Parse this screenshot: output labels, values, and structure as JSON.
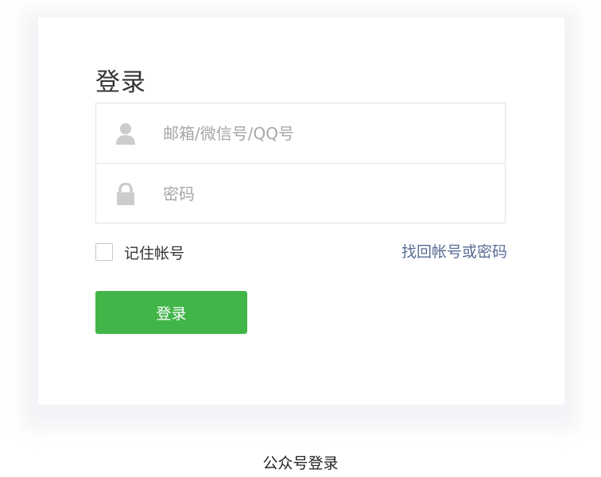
{
  "login_card": {
    "title": "登录",
    "account_field": {
      "placeholder": "邮箱/微信号/QQ号",
      "value": "",
      "icon": "user-icon"
    },
    "password_field": {
      "placeholder": "密码",
      "value": "",
      "icon": "lock-icon"
    },
    "remember": {
      "label": "记住帐号",
      "checked": false
    },
    "forgot_link": "找回帐号或密码",
    "submit_label": "登录"
  },
  "caption": "公众号登录",
  "colors": {
    "primary_button": "#42b549",
    "link": "#576b95",
    "icon": "#cccccc",
    "border": "#e2e2e2"
  }
}
